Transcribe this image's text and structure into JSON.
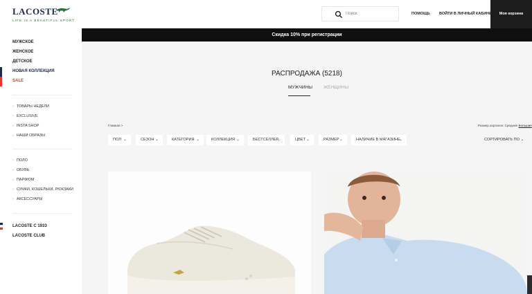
{
  "brand": {
    "name": "LACOSTE",
    "tagline": "LIFE IS A BEAUTIFUL SPORT"
  },
  "search": {
    "placeholder": "Поиск"
  },
  "header": {
    "help": "Помощь",
    "account": "Войти в личный кабинет",
    "cart": "Моя корзина"
  },
  "promo": {
    "text": "Скидка 10% при регистрации"
  },
  "sidebar": {
    "main_items": [
      "Мужское",
      "Женское",
      "Детское",
      "Новая коллекция",
      "SALE"
    ],
    "group1": [
      "ТОВАРЫ НЕДЕЛИ",
      "EXCLUSIVE",
      "INSTA SHOP",
      "НАШИ ОБРАЗЫ"
    ],
    "group2": [
      "ПОЛО",
      "ОБУВЬ",
      "ПАРФЮМ",
      "СУМКИ, КОШЕЛЬКИ, РЮКЗАКИ",
      "АКСЕССУАРЫ"
    ],
    "footer": [
      "LACOSTE С 1933",
      "LACOSTE CLUB"
    ]
  },
  "main": {
    "title": "РАСПРОДАЖА (5218)",
    "tabs": [
      "МУЖЧИНЫ",
      "ЖЕНЩИНЫ"
    ],
    "breadcrumb": "Главная >",
    "view_size_label": "Размер картинок: Средние",
    "view_size_link": "Большие",
    "filters": [
      "Пол",
      "Сезон",
      "Категория",
      "Коллекция",
      "Бестселлер",
      "Цвет",
      "Размер",
      "Наличие в магазине"
    ],
    "sort": "Сортировать по"
  },
  "colors": {
    "brand_navy": "#1b2a4a",
    "sale_red": "#e53a2a",
    "brand_green": "#2a6e3a",
    "banner_bg": "#0f0f0f",
    "page_bg": "#f5f5f5"
  },
  "icons": {
    "search": "search-icon",
    "chevron": "chevron-down-icon",
    "flag": "flag-icon"
  }
}
